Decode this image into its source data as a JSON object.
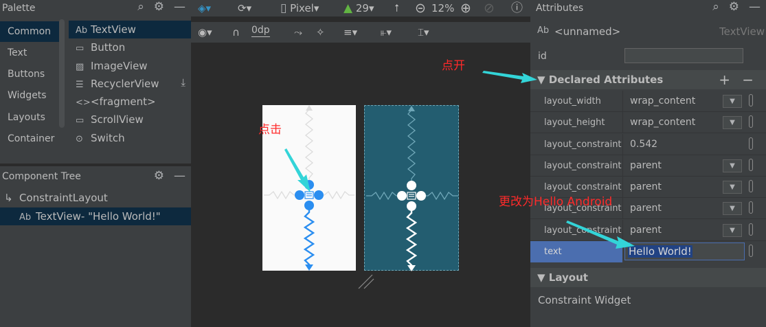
{
  "palette": {
    "title": "Palette",
    "categories": [
      "Common",
      "Text",
      "Buttons",
      "Widgets",
      "Layouts",
      "Container"
    ],
    "selected_category": "Common",
    "widgets": [
      {
        "icon": "Ab",
        "label": "TextView"
      },
      {
        "icon": "▭",
        "label": "Button"
      },
      {
        "icon": "▨",
        "label": "ImageView"
      },
      {
        "icon": "☰",
        "label": "RecyclerView"
      },
      {
        "icon": "<>",
        "label": "<fragment>"
      },
      {
        "icon": "▭",
        "label": "ScrollView"
      },
      {
        "icon": "⊙",
        "label": "Switch"
      }
    ]
  },
  "component_tree": {
    "title": "Component Tree",
    "root": "ConstraintLayout",
    "child_icon": "Ab",
    "child": "TextView- \"Hello World!\""
  },
  "toolbar": {
    "device": "Pixel",
    "api": "29",
    "zoom": "12%",
    "margin": "0dp"
  },
  "attributes": {
    "title": "Attributes",
    "component_icon": "Ab",
    "component_name": "<unnamed>",
    "component_type": "TextView",
    "id_label": "id",
    "id_value": "",
    "declared_title": "Declared Attributes",
    "rows": [
      {
        "name": "layout_width",
        "value": "wrap_content"
      },
      {
        "name": "layout_height",
        "value": "wrap_content"
      },
      {
        "name": "layout_constraint",
        "value": "0.542"
      },
      {
        "name": "layout_constraint",
        "value": "parent"
      },
      {
        "name": "layout_constraint",
        "value": "parent"
      },
      {
        "name": "layout_constraint",
        "value": "parent"
      },
      {
        "name": "layout_constraint",
        "value": "parent"
      }
    ],
    "text_label": "text",
    "text_value": "Hello World!",
    "layout_title": "Layout",
    "constraint_widget": "Constraint Widget"
  },
  "annotations": {
    "expand": "点开",
    "click": "点击",
    "change": "更改为Hello Android"
  },
  "colors": {
    "accent": "#4b6eaf",
    "selection": "#0d293e",
    "arrow": "#33d4d8",
    "annotation": "#ff2a2a",
    "blueprint": "#235d70",
    "handle": "#2b8ef0"
  }
}
